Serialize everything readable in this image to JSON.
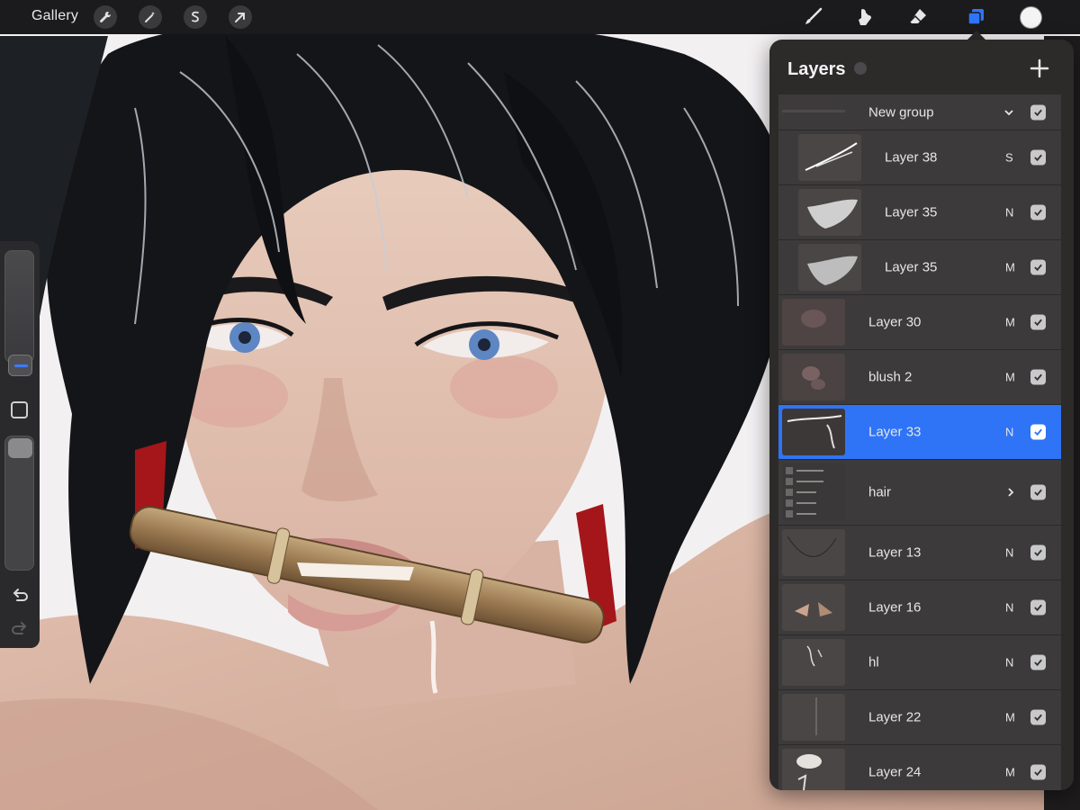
{
  "toolbar": {
    "gallery_label": "Gallery",
    "left_icons": [
      "wrench-icon",
      "magic-wand-icon",
      "selection-icon",
      "transform-arrow-icon"
    ],
    "right_icons": [
      "brush-icon",
      "smudge-icon",
      "eraser-icon",
      "layers-icon"
    ],
    "active_tool": "layers-icon",
    "current_color": "#f4f4f4"
  },
  "layers": {
    "title": "Layers",
    "items": [
      {
        "name": "New group",
        "mode": "",
        "visible": true,
        "kind": "group"
      },
      {
        "name": "Layer 38",
        "mode": "S",
        "visible": true,
        "kind": "layer",
        "indent": true
      },
      {
        "name": "Layer 35",
        "mode": "N",
        "visible": true,
        "kind": "layer",
        "indent": true
      },
      {
        "name": "Layer 35",
        "mode": "M",
        "visible": true,
        "kind": "layer",
        "indent": true
      },
      {
        "name": "Layer 30",
        "mode": "M",
        "visible": true,
        "kind": "layer"
      },
      {
        "name": "blush 2",
        "mode": "M",
        "visible": true,
        "kind": "layer"
      },
      {
        "name": "Layer 33",
        "mode": "N",
        "visible": true,
        "kind": "layer",
        "active": true
      },
      {
        "name": "hair",
        "mode": "",
        "visible": true,
        "kind": "collapsed-group"
      },
      {
        "name": "Layer 13",
        "mode": "N",
        "visible": true,
        "kind": "layer"
      },
      {
        "name": "Layer 16",
        "mode": "N",
        "visible": true,
        "kind": "layer"
      },
      {
        "name": "hl",
        "mode": "N",
        "visible": true,
        "kind": "layer"
      },
      {
        "name": "Layer 22",
        "mode": "M",
        "visible": true,
        "kind": "layer"
      },
      {
        "name": "Layer 24",
        "mode": "M",
        "visible": true,
        "kind": "layer"
      }
    ],
    "active_color": "#2f74f6"
  }
}
